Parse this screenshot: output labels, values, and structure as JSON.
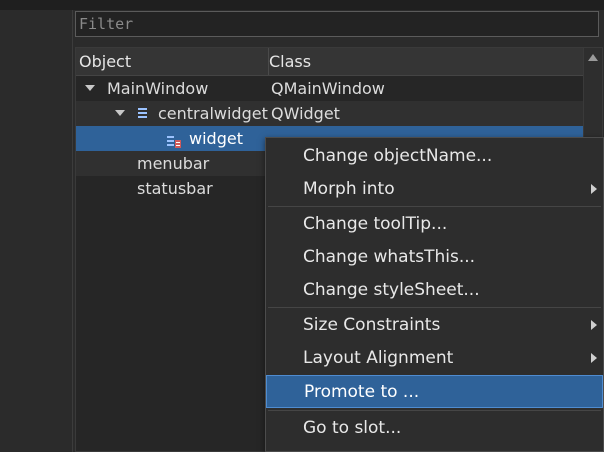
{
  "filter": {
    "placeholder": "Filter",
    "value": ""
  },
  "header": {
    "object": "Object",
    "class": "Class"
  },
  "rows": [
    {
      "object": "MainWindow",
      "class": "QMainWindow"
    },
    {
      "object": "centralwidget",
      "class": "QWidget"
    },
    {
      "object": "widget",
      "class": ""
    },
    {
      "object": "menubar",
      "class": ""
    },
    {
      "object": "statusbar",
      "class": ""
    }
  ],
  "context_menu": {
    "items": [
      {
        "label": "Change objectName..."
      },
      {
        "label": "Morph into"
      },
      {
        "label": "Change toolTip..."
      },
      {
        "label": "Change whatsThis..."
      },
      {
        "label": "Change styleSheet..."
      },
      {
        "label": "Size Constraints"
      },
      {
        "label": "Layout Alignment"
      },
      {
        "label": "Promote to ..."
      },
      {
        "label": "Go to slot..."
      }
    ],
    "highlighted": "Promote to ..."
  },
  "colors": {
    "selection": "#2f6299",
    "background": "#2b2b2b"
  },
  "icons": [
    "expand-arrow-icon",
    "layout-lines-icon",
    "widget-icon",
    "submenu-arrow-icon",
    "scroll-up-icon"
  ]
}
